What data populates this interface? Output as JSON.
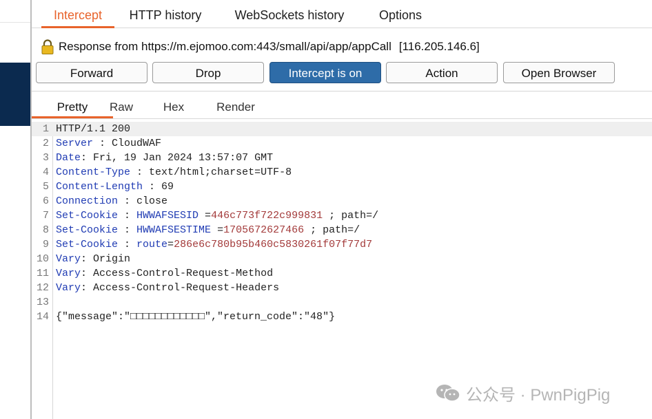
{
  "top_tabs": [
    "Intercept",
    "HTTP history",
    "WebSockets history",
    "Options"
  ],
  "response_line": {
    "label": "Response from https://m.ejomoo.com:443/small/api/app/appCall",
    "ip": "[116.205.146.6]"
  },
  "buttons": {
    "forward": "Forward",
    "drop": "Drop",
    "intercept": "Intercept is on",
    "action": "Action",
    "open_browser": "Open Browser"
  },
  "sub_tabs": [
    "Pretty",
    "Raw",
    "Hex",
    "Render"
  ],
  "lines": [
    {
      "n": "1",
      "a": "HTTP/1.1 200"
    },
    {
      "n": "2",
      "k": "Server",
      "s": " : ",
      "v": "CloudWAF"
    },
    {
      "n": "3",
      "k": "Date",
      "s": ": ",
      "v": "Fri, 19 Jan 2024 13:57:07 GMT"
    },
    {
      "n": "4",
      "k": "Content-Type",
      "s": " : ",
      "v": "text/html;charset=UTF-8"
    },
    {
      "n": "5",
      "k": "Content-Length",
      "s": " : ",
      "v": "69"
    },
    {
      "n": "6",
      "k": "Connection",
      "s": " : ",
      "v": "close"
    },
    {
      "n": "7",
      "k": "Set-Cookie",
      "s": " : ",
      "ck": "HWWAFSESID",
      "eq": " =",
      "cv": "446c773f722c999831",
      "r": " ; path=/"
    },
    {
      "n": "8",
      "k": "Set-Cookie",
      "s": " : ",
      "ck": "HWWAFSESTIME",
      "eq": " =",
      "cv": "1705672627466",
      "r": " ; path=/"
    },
    {
      "n": "9",
      "k": "Set-Cookie",
      "s": " : ",
      "ck": "route",
      "eq": "=",
      "cv": "286e6c780b95b460c5830261f07f77d7",
      "r": ""
    },
    {
      "n": "10",
      "k": "Vary",
      "s": ": ",
      "v": "Origin"
    },
    {
      "n": "11",
      "k": "Vary",
      "s": ": ",
      "v": "Access-Control-Request-Method"
    },
    {
      "n": "12",
      "k": "Vary",
      "s": ": ",
      "v": "Access-Control-Request-Headers"
    },
    {
      "n": "13",
      "a": ""
    },
    {
      "n": "14",
      "a": "{\"message\":\"□□□□□□□□□□□□\",\"return_code\":\"48\"}"
    }
  ],
  "watermark": "公众号 · PwnPigPig",
  "colors": {
    "accent": "#e8632b",
    "intercept_on": "#2e6ca8",
    "header_key": "#1f3bb3",
    "cookie_value": "#a33a3a"
  }
}
